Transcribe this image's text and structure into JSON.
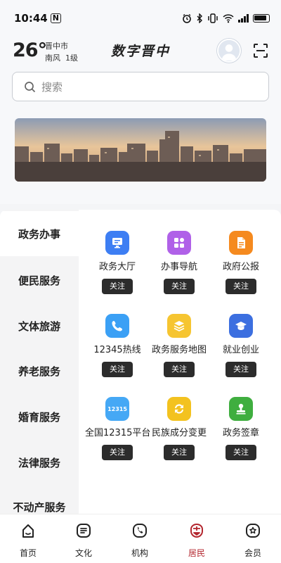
{
  "status_bar": {
    "time": "10:44",
    "nfc_label": "N"
  },
  "weather": {
    "temperature": "26°",
    "city": "晋中市",
    "wind": "南风  1级"
  },
  "brand": {
    "title": "数字晋中"
  },
  "search": {
    "placeholder": "搜索"
  },
  "sidebar": {
    "items": [
      {
        "label": "政务办事",
        "active": true
      },
      {
        "label": "便民服务"
      },
      {
        "label": "文体旅游"
      },
      {
        "label": "养老服务"
      },
      {
        "label": "婚育服务"
      },
      {
        "label": "法律服务"
      },
      {
        "label": "不动产服务"
      }
    ]
  },
  "services": [
    {
      "label": "政务大厅",
      "follow": "关注",
      "icon": "monitor-icon",
      "color": "#3d7ef3"
    },
    {
      "label": "办事导航",
      "follow": "关注",
      "icon": "grid-icon",
      "color": "#b061e8"
    },
    {
      "label": "政府公报",
      "follow": "关注",
      "icon": "document-icon",
      "color": "#f58a1f"
    },
    {
      "label": "12345热线",
      "follow": "关注",
      "icon": "phone-icon",
      "color": "#3ba0f5"
    },
    {
      "label": "政务服务地图",
      "follow": "关注",
      "icon": "layers-icon",
      "color": "#f6c531"
    },
    {
      "label": "就业创业",
      "follow": "关注",
      "icon": "graduation-cap-icon",
      "color": "#3c6fe0"
    },
    {
      "label": "全国12315平台",
      "follow": "关注",
      "icon": "12315-badge-icon",
      "color": "#45a8f5",
      "badge_text": "12315"
    },
    {
      "label": "民族成分变更",
      "follow": "关注",
      "icon": "refresh-icon",
      "color": "#f3c21f"
    },
    {
      "label": "政务签章",
      "follow": "关注",
      "icon": "stamp-icon",
      "color": "#3fae3f"
    }
  ],
  "tabbar": {
    "items": [
      {
        "label": "首页",
        "icon": "home-icon"
      },
      {
        "label": "文化",
        "icon": "culture-icon"
      },
      {
        "label": "机构",
        "icon": "institution-icon"
      },
      {
        "label": "居民",
        "icon": "resident-icon",
        "active": true
      },
      {
        "label": "会员",
        "icon": "member-icon"
      }
    ]
  },
  "colors": {
    "accent_red": "#b3262e",
    "follow_button": "#2c2c2c"
  }
}
